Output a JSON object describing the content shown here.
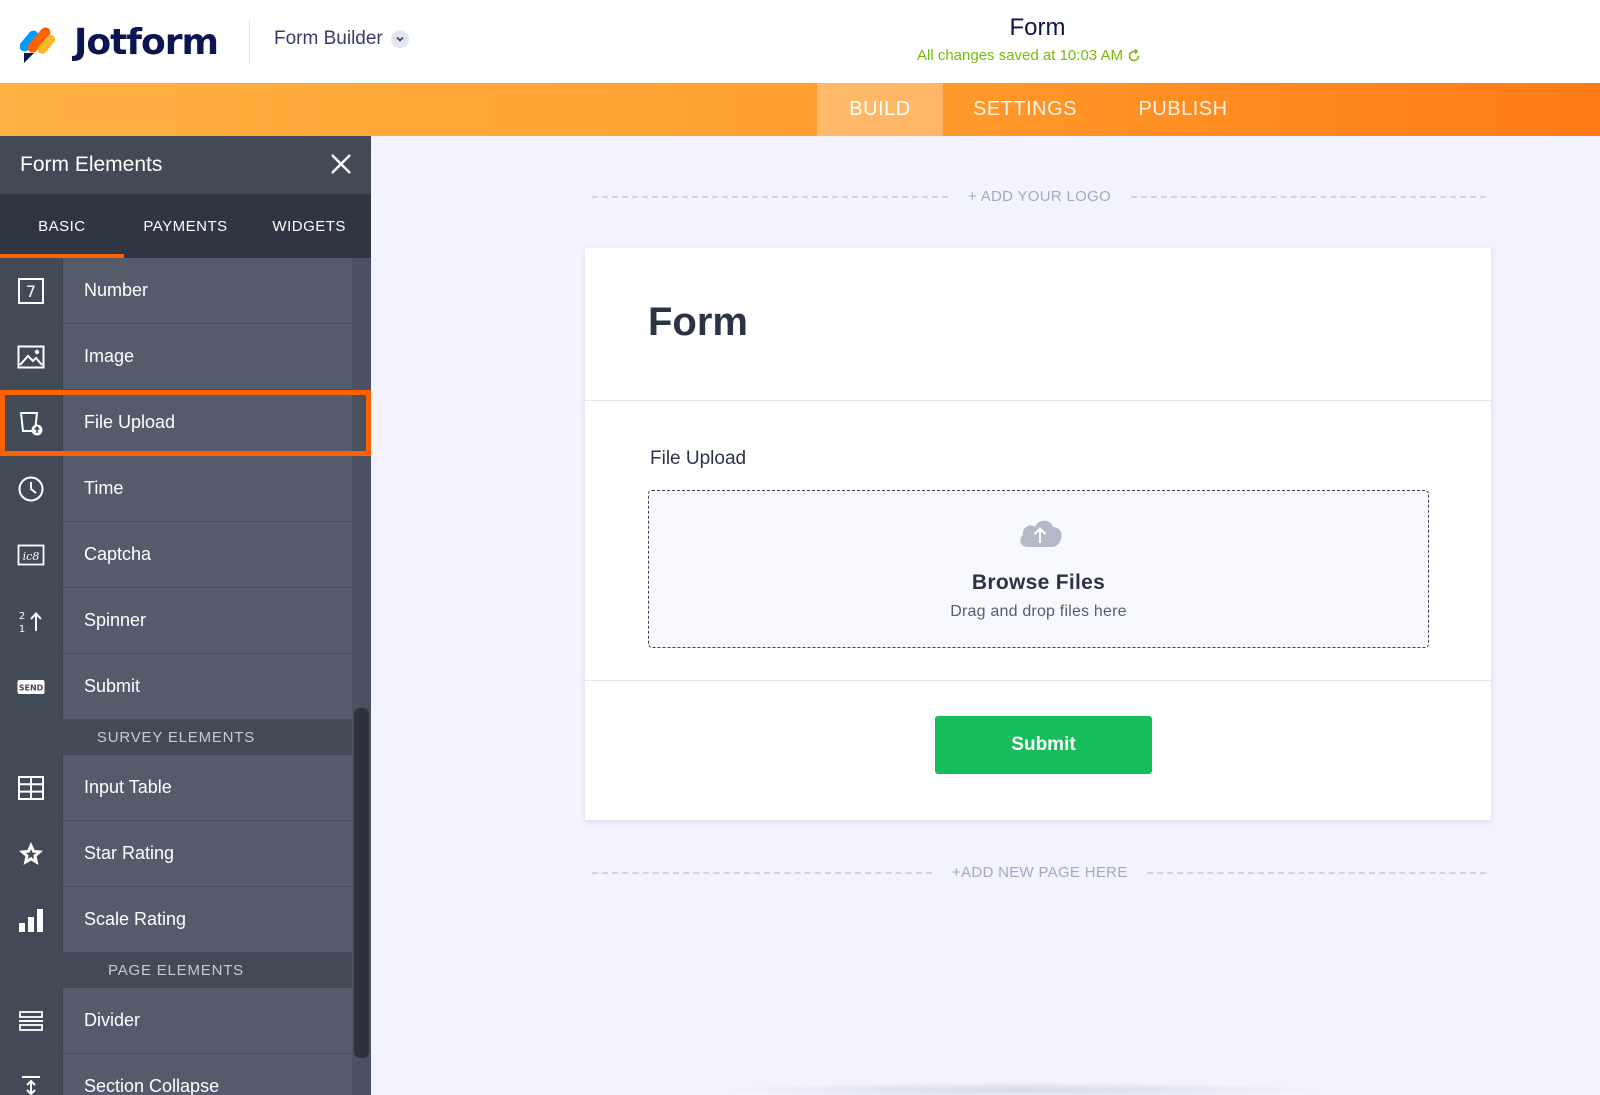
{
  "header": {
    "brand": "Jotform",
    "builder_menu": "Form Builder",
    "form_name": "Form",
    "save_status": "All changes saved at 10:03 AM"
  },
  "nav": {
    "tabs": [
      "BUILD",
      "SETTINGS",
      "PUBLISH"
    ],
    "active": "BUILD"
  },
  "sidebar": {
    "title": "Form Elements",
    "tabs": [
      "BASIC",
      "PAYMENTS",
      "WIDGETS"
    ],
    "active_tab": "BASIC",
    "items": [
      {
        "label": "Number",
        "icon": "number-icon"
      },
      {
        "label": "Image",
        "icon": "image-icon"
      },
      {
        "label": "File Upload",
        "icon": "file-upload-icon",
        "highlighted": true
      },
      {
        "label": "Time",
        "icon": "clock-icon"
      },
      {
        "label": "Captcha",
        "icon": "captcha-icon"
      },
      {
        "label": "Spinner",
        "icon": "spinner-icon"
      },
      {
        "label": "Submit",
        "icon": "send-icon"
      }
    ],
    "survey_heading": "SURVEY ELEMENTS",
    "survey_items": [
      {
        "label": "Input Table",
        "icon": "table-icon"
      },
      {
        "label": "Star Rating",
        "icon": "star-icon"
      },
      {
        "label": "Scale Rating",
        "icon": "bar-chart-icon"
      }
    ],
    "page_heading": "PAGE ELEMENTS",
    "page_items": [
      {
        "label": "Divider",
        "icon": "divider-icon"
      },
      {
        "label": "Section Collapse",
        "icon": "section-collapse-icon"
      }
    ],
    "icon_text": {
      "number": "7",
      "captcha": "ic8",
      "spinner_top": "2",
      "spinner_bottom": "1",
      "send": "SEND"
    }
  },
  "canvas": {
    "add_logo": "+ ADD YOUR LOGO",
    "form_title": "Form",
    "field_label": "File Upload",
    "browse_files": "Browse Files",
    "drag_drop": "Drag and drop files here",
    "submit": "Submit",
    "add_page": "+ADD NEW PAGE HERE"
  },
  "colors": {
    "brand_navy": "#0a1551",
    "accent_orange": "#ff6100",
    "save_green": "#78bb07",
    "submit_green": "#18bd5b",
    "sidebar_bg": "#4f5666"
  }
}
